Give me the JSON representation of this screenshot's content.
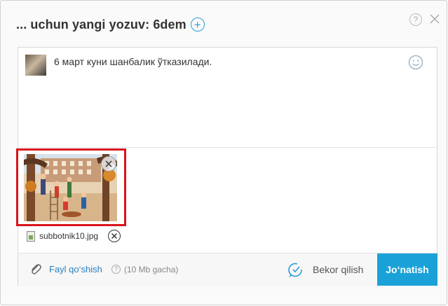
{
  "dialog": {
    "title": "... uchun yangi yozuv: 6dem",
    "add_icon": "plus-circle-icon",
    "help_icon": "help-icon",
    "help_symbol": "?",
    "close_icon": "close-icon"
  },
  "composer": {
    "message": "6 март куни шанбалик ўтказилади.",
    "emoji_icon": "smiley-icon"
  },
  "attachment": {
    "file_name": "subbotnik10.jpg",
    "remove_icon": "close-circle-icon"
  },
  "footer": {
    "attach_label": "Fayl qo‘shish",
    "help_symbol": "?",
    "size_note": "(10 Mb gacha)",
    "cancel_label": "Bekor qilish",
    "send_label": "Jo‘natish",
    "accent_color": "#1aa1d8"
  }
}
